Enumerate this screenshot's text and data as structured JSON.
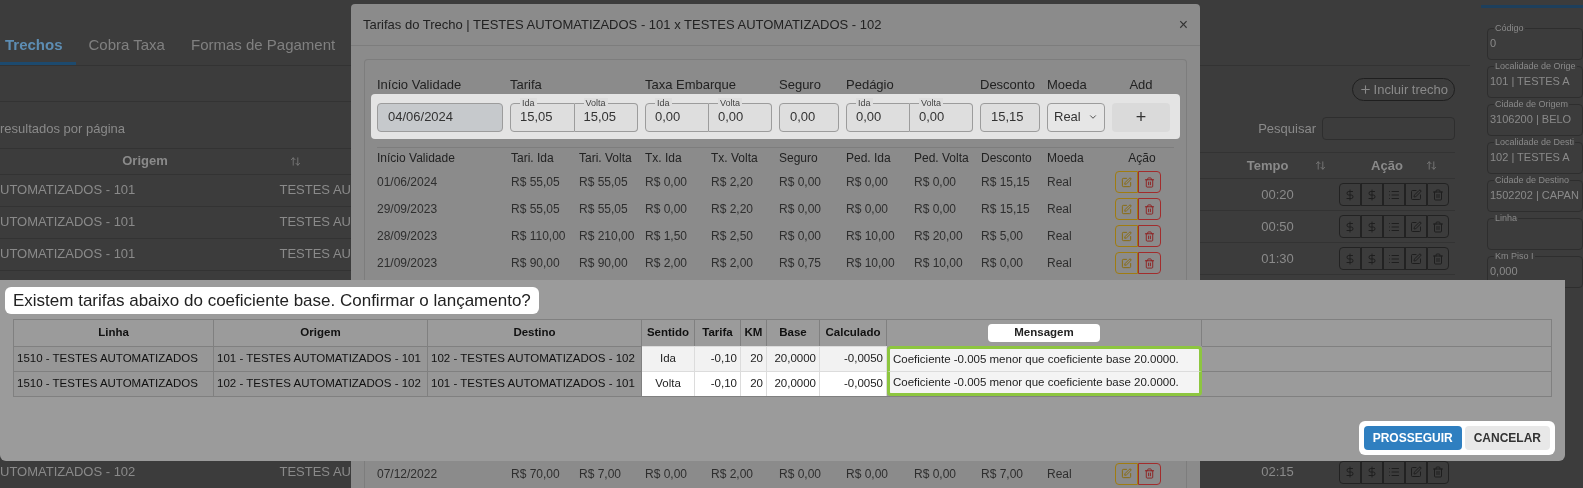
{
  "page": {
    "tabs": [
      {
        "label": "Trechos",
        "selected": true
      },
      {
        "label": "Cobra Taxa",
        "selected": false
      },
      {
        "label": "Formas de Pagament",
        "selected": false
      }
    ],
    "page_size_label": "resultados por página",
    "include_button": "Incluir trecho",
    "search_label": "Pesquisar",
    "table": {
      "columns": [
        "Origem",
        "Tempo",
        "Ação"
      ],
      "rows": [
        {
          "origem": "UTOMATIZADOS - 101",
          "destino": "TESTES AU",
          "tempo": "00:20"
        },
        {
          "origem": "UTOMATIZADOS - 101",
          "destino": "TESTES AU",
          "tempo": "00:50"
        },
        {
          "origem": "UTOMATIZADOS - 101",
          "destino": "TESTES AU",
          "tempo": "01:30"
        },
        {
          "origem": "UTOMATIZADOS - 102",
          "destino": "TESTES AU",
          "tempo": "02:15"
        }
      ]
    },
    "side_fields": [
      {
        "label": "Código",
        "value": "0"
      },
      {
        "label": "Localidade de Orige",
        "value": "101 | TESTES A"
      },
      {
        "label": "Cidade de Origem",
        "value": "3106200 | BELO"
      },
      {
        "label": "Localidade de Desti",
        "value": "102 | TESTES A"
      },
      {
        "label": "Cidade de Destino",
        "value": "1502202 | CAPAN"
      },
      {
        "label": "Linha"
      },
      {
        "label": "Km Piso I",
        "value": "0,000"
      }
    ]
  },
  "modal": {
    "title": "Tarifas do Trecho | TESTES AUTOMATIZADOS - 101 x TESTES AUTOMATIZADOS - 102",
    "close": "×",
    "form": [
      {
        "label": "Início Validade",
        "kind": "date",
        "disabled": true,
        "fields": [
          {
            "value": "04/06/2024"
          }
        ]
      },
      {
        "label": "Tarifa",
        "kind": "pair",
        "fields": [
          {
            "sublabel": "Ida",
            "value": "15,05"
          },
          {
            "sublabel": "Volta",
            "value": "15,05"
          }
        ]
      },
      {
        "label": "Taxa Embarque",
        "kind": "pair",
        "fields": [
          {
            "sublabel": "Ida",
            "value": "0,00"
          },
          {
            "sublabel": "Volta",
            "value": "0,00"
          }
        ]
      },
      {
        "label": "Seguro",
        "kind": "number",
        "disabled": false,
        "fields": [
          {
            "value": "0,00"
          }
        ]
      },
      {
        "label": "Pedágio",
        "kind": "pair",
        "fields": [
          {
            "sublabel": "Ida",
            "value": "0,00"
          },
          {
            "sublabel": "Volta",
            "value": "0,00"
          }
        ]
      },
      {
        "label": "Desconto",
        "kind": "number",
        "disabled": false,
        "fields": [
          {
            "value": "15,15"
          }
        ]
      },
      {
        "label": "Moeda",
        "kind": "select",
        "fields": [
          {
            "value": "Real"
          }
        ]
      },
      {
        "label": "Add",
        "kind": "button",
        "fields": [
          {
            "value": "+"
          }
        ]
      }
    ],
    "table": {
      "columns": [
        "Início Validade",
        "Tari. Ida",
        "Tari. Volta",
        "Tx. Ida",
        "Tx. Volta",
        "Seguro",
        "Ped. Ida",
        "Ped. Volta",
        "Desconto",
        "Moeda",
        "Ação"
      ],
      "rows": [
        {
          "cells": [
            "01/06/2024",
            "R$ 55,05",
            "R$ 55,05",
            "R$ 0,00",
            "R$ 2,20",
            "R$ 0,00",
            "R$ 0,00",
            "R$ 0,00",
            "R$ 15,15",
            "Real"
          ]
        },
        {
          "cells": [
            "29/09/2023",
            "R$ 55,05",
            "R$ 55,05",
            "R$ 0,00",
            "R$ 2,20",
            "R$ 0,00",
            "R$ 0,00",
            "R$ 0,00",
            "R$ 15,15",
            "Real"
          ]
        },
        {
          "cells": [
            "28/09/2023",
            "R$ 110,00",
            "R$ 210,00",
            "R$ 1,50",
            "R$ 2,50",
            "R$ 0,00",
            "R$ 10,00",
            "R$ 20,00",
            "R$ 5,00",
            "Real"
          ]
        },
        {
          "cells": [
            "21/09/2023",
            "R$ 90,00",
            "R$ 90,00",
            "R$ 2,00",
            "R$ 2,00",
            "R$ 0,75",
            "R$ 10,00",
            "R$ 10,00",
            "R$ 0,00",
            "Real"
          ]
        },
        {
          "cells": [
            "07/12/2022",
            "R$ 70,00",
            "R$ 7,00",
            "R$ 0,00",
            "R$ 2,00",
            "R$ 0,00",
            "R$ 0,00",
            "R$ 0,00",
            "R$ 7,00",
            "Real"
          ]
        }
      ]
    }
  },
  "dialog": {
    "message": "Existem tarifas abaixo do coeficiente base. Confirmar o lançamento?",
    "table": {
      "columns": [
        {
          "label": "Linha",
          "highlighted": false,
          "outlined": false
        },
        {
          "label": "Origem",
          "highlighted": false,
          "outlined": false
        },
        {
          "label": "Destino",
          "highlighted": false,
          "outlined": false
        },
        {
          "label": "Sentido",
          "highlighted": true,
          "outlined": false
        },
        {
          "label": "Tarifa",
          "highlighted": true,
          "outlined": false
        },
        {
          "label": "KM",
          "highlighted": true,
          "outlined": false
        },
        {
          "label": "Base",
          "highlighted": true,
          "outlined": false
        },
        {
          "label": "Calculado",
          "highlighted": true,
          "outlined": false
        },
        {
          "label": "Mensagem",
          "highlighted": true,
          "outlined": true
        }
      ],
      "rows": [
        {
          "cells": [
            "1510 - TESTES AUTOMATIZADOS",
            "101 - TESTES AUTOMATIZADOS - 101",
            "102 - TESTES AUTOMATIZADOS - 102",
            "Ida",
            "-0,10",
            "20",
            "20,0000",
            "-0,0050",
            "Coeficiente -0.005 menor que coeficiente base 20.0000."
          ]
        },
        {
          "cells": [
            "1510 - TESTES AUTOMATIZADOS",
            "102 - TESTES AUTOMATIZADOS - 102",
            "101 - TESTES AUTOMATIZADOS - 101",
            "Volta",
            "-0,10",
            "20",
            "20,0000",
            "-0,0050",
            "Coeficiente -0.005 menor que coeficiente base 20.0000."
          ]
        }
      ]
    },
    "buttons": [
      {
        "label": "PROSSEGUIR",
        "kind": "primary"
      },
      {
        "label": "CANCELAR",
        "kind": "secondary"
      }
    ]
  }
}
